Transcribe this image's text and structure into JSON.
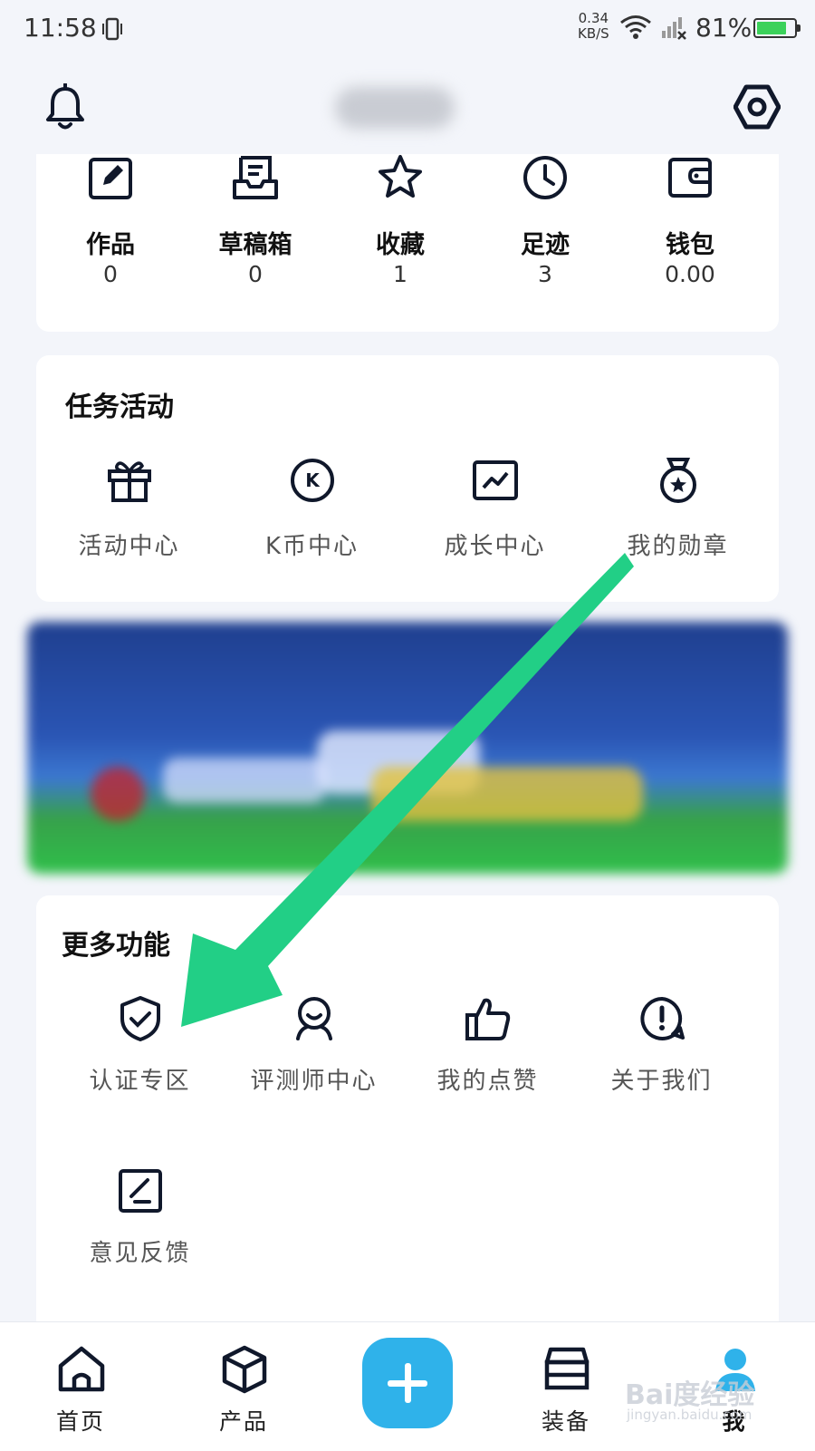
{
  "status_bar": {
    "time": "11:58",
    "net_speed_value": "0.34",
    "net_speed_unit": "KB/S",
    "battery_percent": "81%",
    "battery_level": 0.81,
    "battery_color": "#3bd15a"
  },
  "header": {
    "left_icon": "bell-icon",
    "right_icon": "settings-hexagon-icon"
  },
  "stats": [
    {
      "label": "作品",
      "value": "0",
      "icon": "edit-document-icon"
    },
    {
      "label": "草稿箱",
      "value": "0",
      "icon": "draft-tray-icon"
    },
    {
      "label": "收藏",
      "value": "1",
      "icon": "star-icon"
    },
    {
      "label": "足迹",
      "value": "3",
      "icon": "clock-icon"
    },
    {
      "label": "钱包",
      "value": "0.00",
      "icon": "wallet-icon"
    }
  ],
  "tasks": {
    "title": "任务活动",
    "items": [
      {
        "label": "活动中心",
        "icon": "gift-icon"
      },
      {
        "label": "K币中心",
        "icon": "k-coin-icon"
      },
      {
        "label": "成长中心",
        "icon": "growth-chart-icon"
      },
      {
        "label": "我的勋章",
        "icon": "medal-icon"
      }
    ]
  },
  "more": {
    "title": "更多功能",
    "items": [
      {
        "label": "认证专区",
        "icon": "shield-check-icon"
      },
      {
        "label": "评测师中心",
        "icon": "reviewer-icon"
      },
      {
        "label": "我的点赞",
        "icon": "thumbs-up-icon"
      },
      {
        "label": "关于我们",
        "icon": "info-bubble-icon"
      },
      {
        "label": "意见反馈",
        "icon": "feedback-icon"
      }
    ]
  },
  "tabbar": {
    "items": [
      {
        "label": "首页",
        "icon": "home-icon"
      },
      {
        "label": "产品",
        "icon": "box-icon"
      },
      {
        "label": "",
        "icon": "plus-icon"
      },
      {
        "label": "装备",
        "icon": "equipment-box-icon"
      },
      {
        "label": "我",
        "icon": "user-icon",
        "active": true
      }
    ],
    "accent": "#2fb2ea"
  },
  "annotation": {
    "arrow_color": "#22cf86"
  },
  "watermark": {
    "text": "Bai度经验",
    "sub": "jingyan.baidu.com"
  }
}
